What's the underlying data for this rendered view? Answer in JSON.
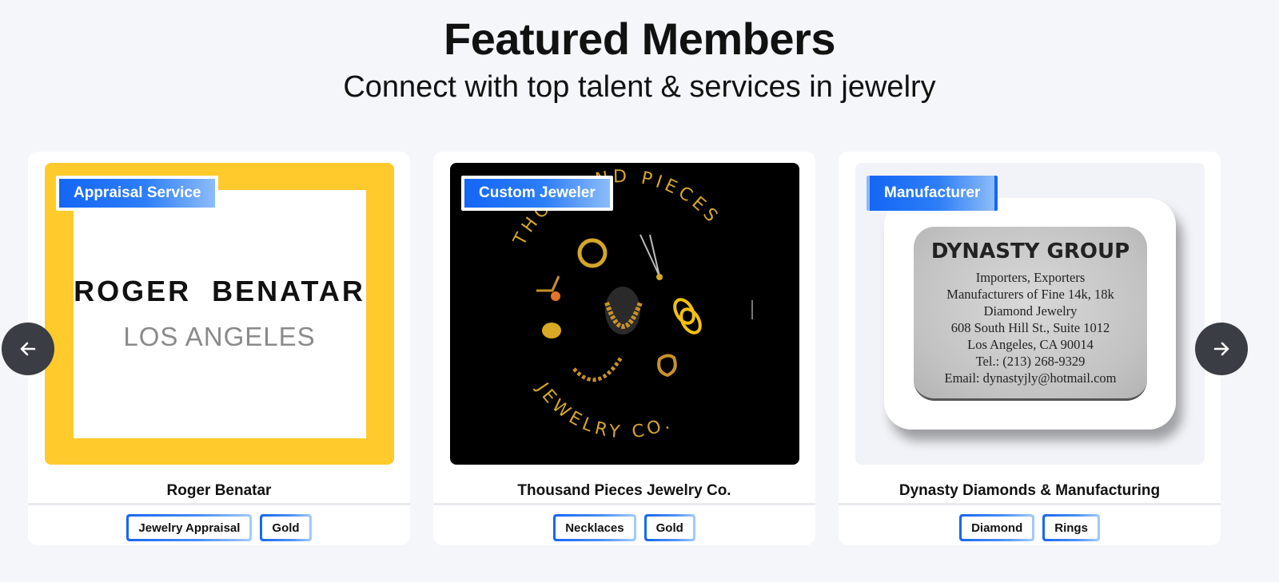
{
  "header": {
    "title": "Featured Members",
    "subtitle": "Connect with top talent & services in jewelry"
  },
  "carousel": {
    "prev_icon": "arrow-left-icon",
    "next_icon": "arrow-right-icon"
  },
  "members": [
    {
      "badge": "Appraisal Service",
      "name": "Roger Benatar",
      "tags": [
        "Jewelry Appraisal",
        "Gold"
      ],
      "logo": {
        "line1": "ROGER  BENATAR",
        "line2": "LOS ANGELES",
        "bg": "#ffca2c"
      }
    },
    {
      "badge": "Custom Jeweler",
      "name": "Thousand Pieces Jewelry Co.",
      "tags": [
        "Necklaces",
        "Gold"
      ],
      "logo": {
        "arc_top": "THOUSAND PIECES",
        "arc_bottom": "JEWELRY CO.",
        "bg": "#000000",
        "accent": "#d4a62a"
      }
    },
    {
      "badge": "Manufacturer",
      "name": "Dynasty Diamonds & Manufacturing",
      "tags": [
        "Diamond",
        "Rings"
      ],
      "logo": {
        "title": "DYNASTY GROUP",
        "lines": [
          "Importers, Exporters",
          "Manufacturers of Fine 14k, 18k",
          "Diamond Jewelry",
          "608 South Hill St., Suite 1012",
          "Los Angeles, CA 90014",
          "Tel.: (213) 268-9329",
          "Email: dynastyjly@hotmail.com"
        ]
      }
    }
  ],
  "colors": {
    "badge_blue": "#1466f5",
    "page_bg": "#f5f6fa",
    "arrow_bg": "#3a3d44"
  }
}
